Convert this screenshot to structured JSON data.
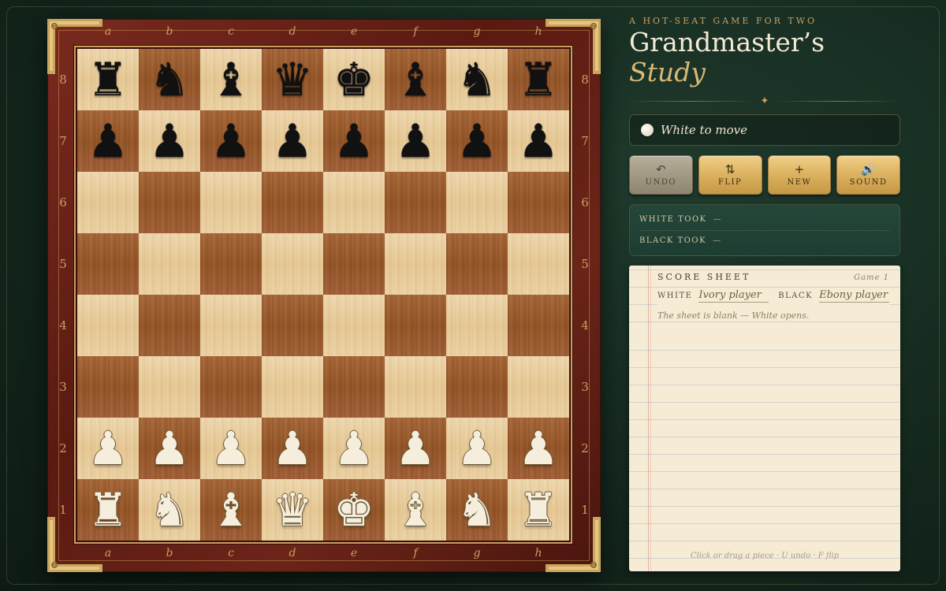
{
  "files": [
    "a",
    "b",
    "c",
    "d",
    "e",
    "f",
    "g",
    "h"
  ],
  "ranks": [
    "8",
    "7",
    "6",
    "5",
    "4",
    "3",
    "2",
    "1"
  ],
  "board": [
    [
      "br",
      "bn",
      "bb",
      "bq",
      "bk",
      "bb",
      "bn",
      "br"
    ],
    [
      "bp",
      "bp",
      "bp",
      "bp",
      "bp",
      "bp",
      "bp",
      "bp"
    ],
    [
      "",
      "",
      "",
      "",
      "",
      "",
      "",
      ""
    ],
    [
      "",
      "",
      "",
      "",
      "",
      "",
      "",
      ""
    ],
    [
      "",
      "",
      "",
      "",
      "",
      "",
      "",
      ""
    ],
    [
      "",
      "",
      "",
      "",
      "",
      "",
      "",
      ""
    ],
    [
      "wp",
      "wp",
      "wp",
      "wp",
      "wp",
      "wp",
      "wp",
      "wp"
    ],
    [
      "wr",
      "wn",
      "wb",
      "wq",
      "wk",
      "wb",
      "wn",
      "wr"
    ]
  ],
  "header": {
    "eyebrow": "A HOT-SEAT GAME FOR TWO",
    "title_main": "Grandmaster’s",
    "title_accent": "Study",
    "ornament": "✦"
  },
  "status": {
    "text": "White to move"
  },
  "controls": {
    "undo": {
      "icon": "undo-arrow-icon",
      "glyph": "↶",
      "label": "UNDO"
    },
    "flip": {
      "icon": "flip-arrows-icon",
      "glyph": "⇅",
      "label": "FLIP"
    },
    "new": {
      "icon": "plus-icon",
      "glyph": "+",
      "label": "NEW"
    },
    "sound": {
      "icon": "speaker-icon",
      "glyph": "🔊",
      "label": "SOUND"
    }
  },
  "captures": {
    "white_label": "WHITE TOOK",
    "white_value": "—",
    "black_label": "BLACK TOOK",
    "black_value": "—"
  },
  "scoresheet": {
    "title": "SCORE SHEET",
    "game": "Game 1",
    "white_label": "WHITE",
    "white_name": "Ivory player",
    "black_label": "BLACK",
    "black_name": "Ebony player",
    "empty_text": "The sheet is blank — White opens."
  },
  "hint": "Click or drag a piece · U undo · F flip",
  "colors": {
    "accent_gold": "#c9a063",
    "background": "#14271d",
    "board_frame": "#6b2418",
    "light_square": "#ecd3a5",
    "dark_square": "#9d5c30"
  }
}
